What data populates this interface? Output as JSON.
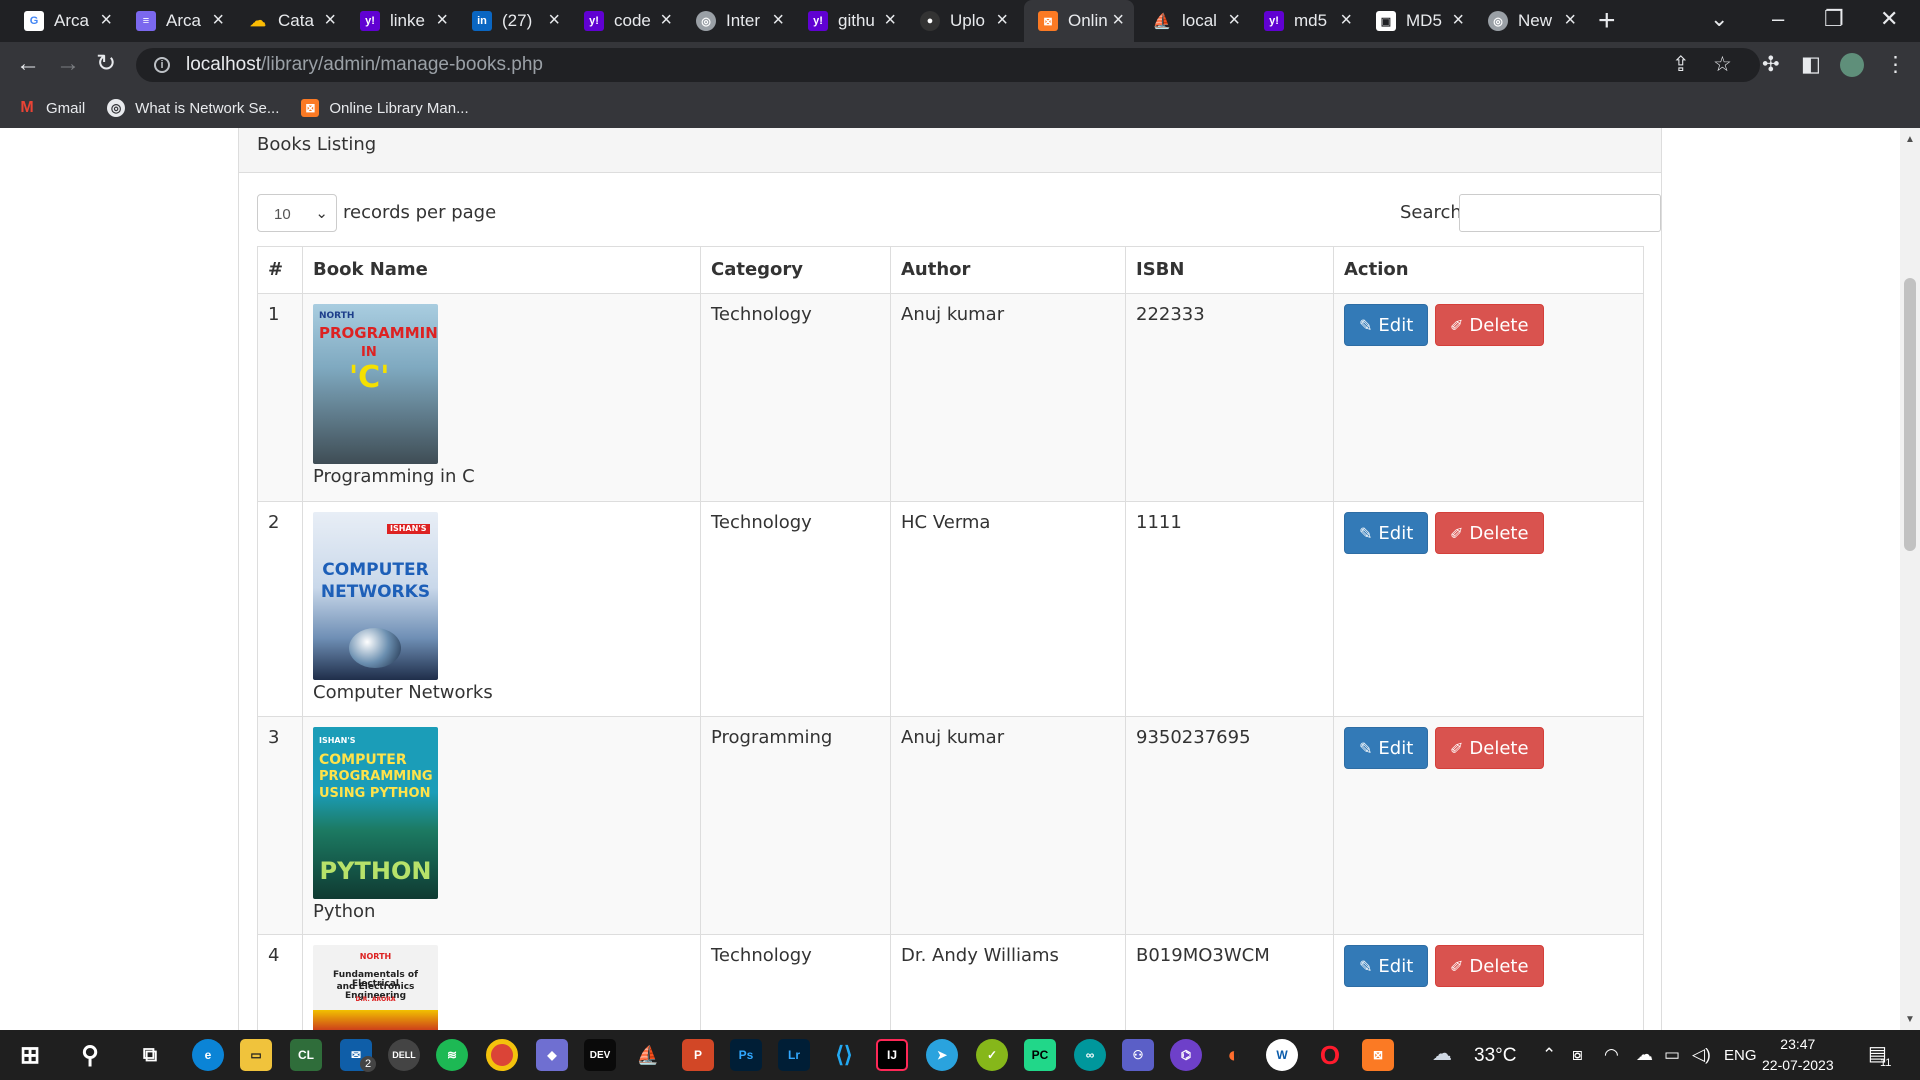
{
  "browser": {
    "tabs": [
      {
        "title": "Arca",
        "icon": "google-icon",
        "color": "#ffffff"
      },
      {
        "title": "Arca",
        "icon": "doc-list-icon",
        "color": "#7b68ee"
      },
      {
        "title": "Cata",
        "icon": "cloud-icon",
        "color": "#4285f4"
      },
      {
        "title": "linke",
        "icon": "yahoo-icon",
        "color": "#6001d2"
      },
      {
        "title": "(27)",
        "icon": "linkedin-icon",
        "color": "#0a66c2"
      },
      {
        "title": "code",
        "icon": "yahoo-icon",
        "color": "#6001d2"
      },
      {
        "title": "Inter",
        "icon": "globe-icon",
        "color": "#9aa0a6"
      },
      {
        "title": "githu",
        "icon": "yahoo-icon",
        "color": "#6001d2"
      },
      {
        "title": "Uplo",
        "icon": "github-icon",
        "color": "#333333"
      },
      {
        "title": "Onlin",
        "icon": "xampp-icon",
        "color": "#fb7a24",
        "active": true
      },
      {
        "title": "local",
        "icon": "phpmyadmin-icon",
        "color": "#f0a30a"
      },
      {
        "title": "md5",
        "icon": "yahoo-icon",
        "color": "#6001d2"
      },
      {
        "title": "MD5",
        "icon": "lock-icon",
        "color": "#ffffff"
      },
      {
        "title": "New",
        "icon": "globe-icon",
        "color": "#9aa0a6"
      }
    ],
    "url_host": "localhost",
    "url_path": "/library/admin/manage-books.php",
    "bookmarks": [
      {
        "label": "Gmail",
        "icon": "gmail-icon"
      },
      {
        "label": "What is Network Se...",
        "icon": "globe-icon"
      },
      {
        "label": "Online Library Man...",
        "icon": "xampp-icon"
      }
    ]
  },
  "panel": {
    "heading": "Books Listing",
    "page_length": "10",
    "records_per_page_label": "records per page",
    "search_label": "Search:",
    "search_value": ""
  },
  "table": {
    "headers": [
      "#",
      "Book Name",
      "Category",
      "Author",
      "ISBN",
      "Action"
    ],
    "rows": [
      {
        "num": "1",
        "name": "Programming in C",
        "category": "Technology",
        "author": "Anuj kumar",
        "isbn": "222333",
        "cover": {
          "lines": [
            "NORTH",
            "PROGRAMMING",
            "IN",
            "'C'"
          ]
        }
      },
      {
        "num": "2",
        "name": "Computer Networks",
        "category": "Technology",
        "author": "HC Verma",
        "isbn": "1111",
        "cover": {
          "lines": [
            "ISHAN'S",
            "COMPUTER",
            "NETWORKS"
          ]
        }
      },
      {
        "num": "3",
        "name": "Python",
        "category": "Programming",
        "author": "Anuj kumar",
        "isbn": "9350237695",
        "cover": {
          "lines": [
            "ISHAN'S",
            "COMPUTER",
            "PROGRAMMING",
            "USING PYTHON",
            "PYTHON"
          ]
        }
      },
      {
        "num": "4",
        "name": "",
        "category": "Technology",
        "author": "Dr. Andy Williams",
        "isbn": "B019MO3WCM",
        "cover": {
          "lines": [
            "NORTH",
            "Fundamentals of Electrical",
            "and Electronics Engineering",
            "D.R. ARORA"
          ]
        }
      }
    ],
    "edit_label": "Edit",
    "delete_label": "Delete"
  },
  "taskbar": {
    "weather": "33°C",
    "lang": "ENG",
    "time": "23:47",
    "date": "22-07-2023",
    "notifications": "11",
    "badge": "2"
  }
}
